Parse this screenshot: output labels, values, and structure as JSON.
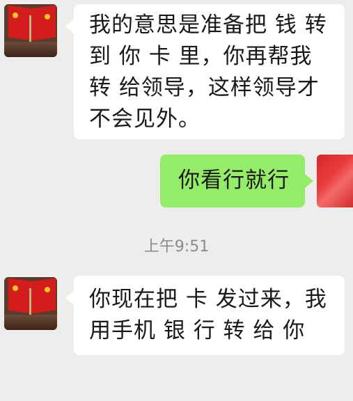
{
  "messages": [
    {
      "id": "m1",
      "direction": "incoming",
      "lines": [
        "我的意思是准备把 钱 转",
        "到 你 卡 里，你再帮我",
        "转 给领导，这样领导才",
        "不会见外。"
      ]
    },
    {
      "id": "m2",
      "direction": "outgoing",
      "lines": [
        "你看行就行"
      ]
    },
    {
      "id": "m3",
      "direction": "incoming",
      "lines": [
        "你现在把 卡 发过来，我",
        "用手机 银 行 转 给 你"
      ]
    }
  ],
  "timestamp": "上午9:51",
  "colors": {
    "background": "#ededed",
    "incoming_bubble": "#ffffff",
    "outgoing_bubble": "#95ec69",
    "timestamp_text": "#8a8a8a"
  },
  "icons": {
    "sender_avatar": "flags-avatar-icon",
    "self_avatar": "red-avatar-icon"
  }
}
